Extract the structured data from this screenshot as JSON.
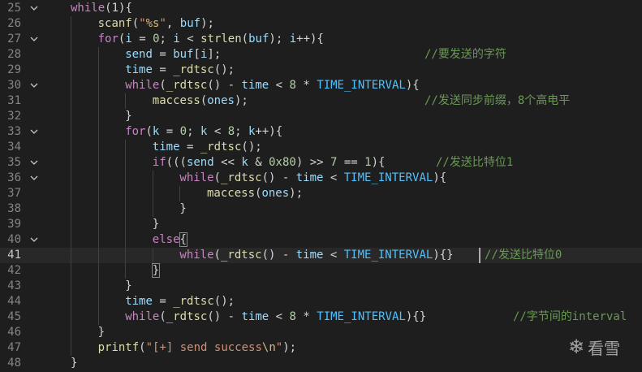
{
  "editor": {
    "lines": [
      {
        "n": "25",
        "code": [
          [
            "kw",
            "while"
          ],
          [
            "",
            "(1){"
          ]
        ]
      },
      {
        "n": "26",
        "code": [
          [
            "fn",
            "scanf"
          ],
          [
            "",
            "("
          ],
          [
            "str",
            "\""
          ],
          [
            "esc",
            "%s"
          ],
          [
            "str",
            "\""
          ],
          [
            "",
            ", "
          ],
          [
            "var",
            "buf"
          ],
          [
            "",
            ");"
          ]
        ]
      },
      {
        "n": "27",
        "code": [
          [
            "kw",
            "for"
          ],
          [
            "",
            "("
          ],
          [
            "var",
            "i"
          ],
          [
            "",
            " = "
          ],
          [
            "num",
            "0"
          ],
          [
            "",
            "; "
          ],
          [
            "var",
            "i"
          ],
          [
            "",
            " < "
          ],
          [
            "fn",
            "strlen"
          ],
          [
            "",
            "("
          ],
          [
            "var",
            "buf"
          ],
          [
            "",
            "); "
          ],
          [
            "var",
            "i"
          ],
          [
            "",
            "++){"
          ]
        ]
      },
      {
        "n": "28",
        "code": [
          [
            "var",
            "send"
          ],
          [
            "",
            " = "
          ],
          [
            "var",
            "buf"
          ],
          [
            "",
            "["
          ],
          [
            "var",
            "i"
          ],
          [
            "",
            "];"
          ]
        ],
        "comment": "//要发送的字符"
      },
      {
        "n": "29",
        "code": [
          [
            "var",
            "time"
          ],
          [
            "",
            " = "
          ],
          [
            "fn",
            "_rdtsc"
          ],
          [
            "",
            "();"
          ]
        ]
      },
      {
        "n": "30",
        "code": [
          [
            "kw",
            "while"
          ],
          [
            "",
            "("
          ],
          [
            "fn",
            "_rdtsc"
          ],
          [
            "",
            "() - "
          ],
          [
            "var",
            "time"
          ],
          [
            "",
            " < "
          ],
          [
            "num",
            "8"
          ],
          [
            "",
            " * "
          ],
          [
            "const",
            "TIME_INTERVAL"
          ],
          [
            "",
            "){"
          ]
        ]
      },
      {
        "n": "31",
        "code": [
          [
            "fn",
            "maccess"
          ],
          [
            "",
            "("
          ],
          [
            "var",
            "ones"
          ],
          [
            "",
            ");"
          ]
        ],
        "comment": "//发送同步前缀，8个高电平"
      },
      {
        "n": "32",
        "code": [
          [
            "",
            "}"
          ]
        ]
      },
      {
        "n": "33",
        "code": [
          [
            "kw",
            "for"
          ],
          [
            "",
            "("
          ],
          [
            "var",
            "k"
          ],
          [
            "",
            " = "
          ],
          [
            "num",
            "0"
          ],
          [
            "",
            "; "
          ],
          [
            "var",
            "k"
          ],
          [
            "",
            " < "
          ],
          [
            "num",
            "8"
          ],
          [
            "",
            "; "
          ],
          [
            "var",
            "k"
          ],
          [
            "",
            "++){"
          ]
        ]
      },
      {
        "n": "34",
        "code": [
          [
            "var",
            "time"
          ],
          [
            "",
            " = "
          ],
          [
            "fn",
            "_rdtsc"
          ],
          [
            "",
            "();"
          ]
        ]
      },
      {
        "n": "35",
        "code": [
          [
            "kw",
            "if"
          ],
          [
            "",
            "((("
          ],
          [
            "var",
            "send"
          ],
          [
            "",
            " << "
          ],
          [
            "var",
            "k"
          ],
          [
            "",
            " & "
          ],
          [
            "num",
            "0x80"
          ],
          [
            "",
            ") >> "
          ],
          [
            "num",
            "7"
          ],
          [
            "",
            " == "
          ],
          [
            "num",
            "1"
          ],
          [
            "",
            "){"
          ]
        ],
        "comment": "//发送比特位1"
      },
      {
        "n": "36",
        "code": [
          [
            "kw",
            "while"
          ],
          [
            "",
            "("
          ],
          [
            "fn",
            "_rdtsc"
          ],
          [
            "",
            "() - "
          ],
          [
            "var",
            "time"
          ],
          [
            "",
            " < "
          ],
          [
            "const",
            "TIME_INTERVAL"
          ],
          [
            "",
            "){"
          ]
        ]
      },
      {
        "n": "37",
        "code": [
          [
            "fn",
            "maccess"
          ],
          [
            "",
            "("
          ],
          [
            "var",
            "ones"
          ],
          [
            "",
            ");"
          ]
        ]
      },
      {
        "n": "38",
        "code": [
          [
            "",
            "}"
          ]
        ]
      },
      {
        "n": "39",
        "code": [
          [
            "",
            "}"
          ]
        ]
      },
      {
        "n": "40",
        "code": [
          [
            "kw",
            "else"
          ],
          [
            "brkt",
            "{"
          ]
        ]
      },
      {
        "n": "41",
        "code": [
          [
            "kw",
            "while"
          ],
          [
            "",
            "("
          ],
          [
            "fn",
            "_rdtsc"
          ],
          [
            "",
            "() - "
          ],
          [
            "var",
            "time"
          ],
          [
            "",
            " < "
          ],
          [
            "const",
            "TIME_INTERVAL"
          ],
          [
            "",
            "){}"
          ]
        ],
        "comment": "//发送比特位0"
      },
      {
        "n": "42",
        "code": [
          [
            "brkt",
            "}"
          ]
        ]
      },
      {
        "n": "43",
        "code": [
          [
            "",
            "}"
          ]
        ]
      },
      {
        "n": "44",
        "code": [
          [
            "var",
            "time"
          ],
          [
            "",
            " = "
          ],
          [
            "fn",
            "_rdtsc"
          ],
          [
            "",
            "();"
          ]
        ]
      },
      {
        "n": "45",
        "code": [
          [
            "kw",
            "while"
          ],
          [
            "",
            "("
          ],
          [
            "fn",
            "_rdtsc"
          ],
          [
            "",
            "() - "
          ],
          [
            "var",
            "time"
          ],
          [
            "",
            " < "
          ],
          [
            "num",
            "8"
          ],
          [
            "",
            " * "
          ],
          [
            "const",
            "TIME_INTERVAL"
          ],
          [
            "",
            "){}"
          ]
        ],
        "comment": "//字节间的interval"
      },
      {
        "n": "46",
        "code": [
          [
            "",
            "}"
          ]
        ]
      },
      {
        "n": "47",
        "code": [
          [
            "fn",
            "printf"
          ],
          [
            "",
            "("
          ],
          [
            "str",
            "\"[+] send success"
          ],
          [
            "esc",
            "\\n"
          ],
          [
            "str",
            "\""
          ],
          [
            "",
            ");"
          ]
        ]
      },
      {
        "n": "48",
        "code": [
          [
            "",
            "}"
          ]
        ]
      }
    ]
  },
  "watermark": {
    "icon": "snowflake-icon",
    "text": "看雪"
  }
}
